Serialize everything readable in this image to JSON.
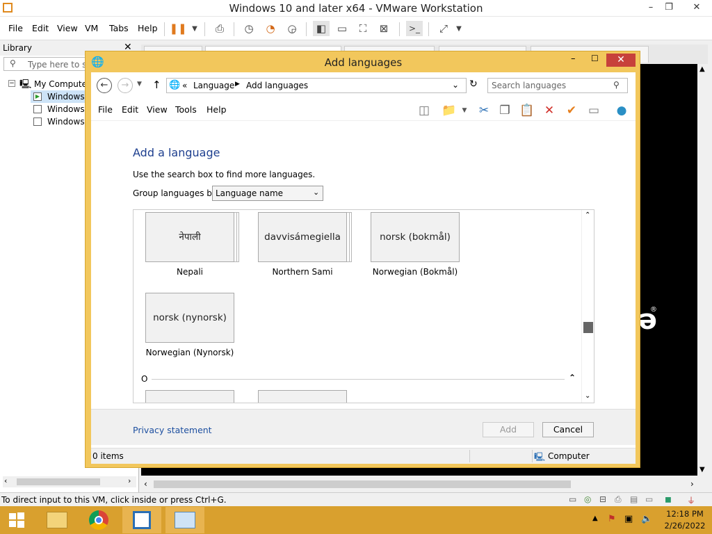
{
  "vm": {
    "title": "Windows 10 and later x64 - VMware Workstation",
    "menus": [
      "File",
      "Edit",
      "View",
      "VM",
      "Tabs",
      "Help"
    ],
    "status_text": "To direct input to this VM, click inside or press Ctrl+G."
  },
  "library": {
    "title": "Library",
    "search_placeholder": "Type here to search",
    "tree": [
      "My Computer",
      "Windows 1",
      "Windows",
      "Windows S"
    ]
  },
  "dialog": {
    "title": "Add languages",
    "breadcrumb": [
      "Language",
      "Add languages"
    ],
    "search_placeholder": "Search languages",
    "menus": [
      "File",
      "Edit",
      "View",
      "Tools",
      "Help"
    ],
    "heading": "Add a language",
    "help_text": "Use the search box to find more languages.",
    "group_label": "Group languages by:",
    "group_value": "Language name",
    "languages": [
      {
        "native": "नेपाली",
        "name": "Nepali"
      },
      {
        "native": "davvisámegiella",
        "name": "Northern Sami"
      },
      {
        "native": "norsk (bokmål)",
        "name": "Norwegian (Bokmål)"
      },
      {
        "native": "norsk (nynorsk)",
        "name": "Norwegian (Nynorsk)"
      }
    ],
    "section_letter": "O",
    "privacy_link": "Privacy statement",
    "add_button": "Add",
    "cancel_button": "Cancel",
    "status_items": "0 items",
    "status_location": "Computer"
  },
  "taskbar": {
    "time": "12:18 PM",
    "date": "2/26/2022"
  },
  "colors": {
    "accent": "#f2c75c",
    "taskbar": "#d9a02e",
    "close_red": "#c7413b",
    "link_blue": "#1e50a0"
  }
}
